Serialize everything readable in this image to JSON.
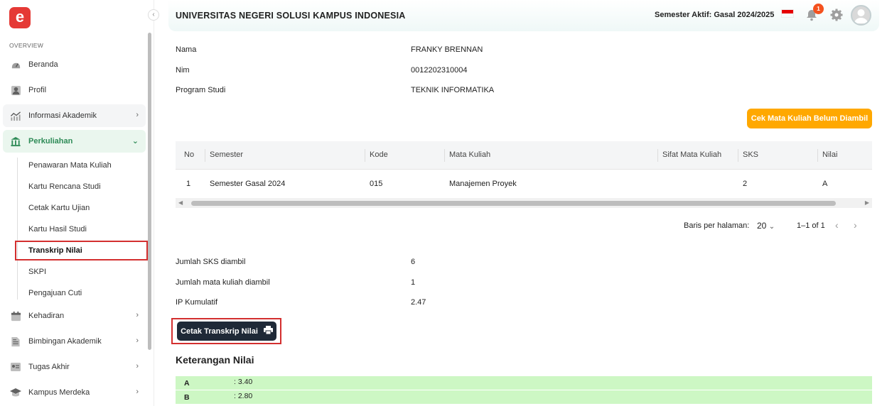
{
  "sidebar": {
    "logo": "e",
    "section_label": "OVERVIEW",
    "items": [
      {
        "label": "Beranda"
      },
      {
        "label": "Profil"
      },
      {
        "label": "Informasi Akademik"
      },
      {
        "label": "Perkuliahan"
      },
      {
        "label": "Kehadiran"
      },
      {
        "label": "Bimbingan Akademik"
      },
      {
        "label": "Tugas Akhir"
      },
      {
        "label": "Kampus Merdeka"
      }
    ],
    "subitems": [
      {
        "label": "Penawaran Mata Kuliah"
      },
      {
        "label": "Kartu Rencana Studi"
      },
      {
        "label": "Cetak Kartu Ujian"
      },
      {
        "label": "Kartu Hasil Studi"
      },
      {
        "label": "Transkrip Nilai"
      },
      {
        "label": "SKPI"
      },
      {
        "label": "Pengajuan Cuti"
      }
    ]
  },
  "header": {
    "title": "UNIVERSITAS NEGERI SOLUSI KAMPUS INDONESIA",
    "semester": "Semester Aktif: Gasal 2024/2025",
    "notification_count": "1",
    "flag_colors": [
      "#e50000",
      "#ffffff"
    ]
  },
  "student": {
    "name_label": "Nama",
    "name": "FRANKY BRENNAN",
    "nim_label": "Nim",
    "nim": "0012202310004",
    "prodi_label": "Program Studi",
    "prodi": "TEKNIK INFORMATIKA"
  },
  "actions": {
    "check_button": "Cek Mata Kuliah Belum Diambil",
    "print_button": "Cetak Transkrip Nilai"
  },
  "table": {
    "headers": [
      "No",
      "Semester",
      "Kode",
      "Mata Kuliah",
      "Sifat Mata Kuliah",
      "SKS",
      "Nilai"
    ],
    "rows": [
      [
        "1",
        "Semester Gasal 2024",
        "015",
        "Manajemen Proyek",
        "",
        "2",
        "A"
      ]
    ]
  },
  "pagination": {
    "rows_label": "Baris per halaman:",
    "rows_value": "20",
    "range": "1–1 of 1"
  },
  "summary": {
    "sks_label": "Jumlah SKS diambil",
    "sks": "6",
    "mk_label": "Jumlah mata kuliah diambil",
    "mk": "1",
    "ipk_label": "IP Kumulatif",
    "ipk": "2.47"
  },
  "keterangan": {
    "title": "Keterangan Nilai",
    "grades": [
      {
        "grade": "A",
        "score": ": 3.40"
      },
      {
        "grade": "B",
        "score": ": 2.80"
      }
    ]
  },
  "colors": {
    "accent": "#2e8b57",
    "orange": "#ffa800",
    "dark": "#1f2937",
    "highlight": "#d32f2f",
    "grade_bg": "#cdf7c4"
  }
}
